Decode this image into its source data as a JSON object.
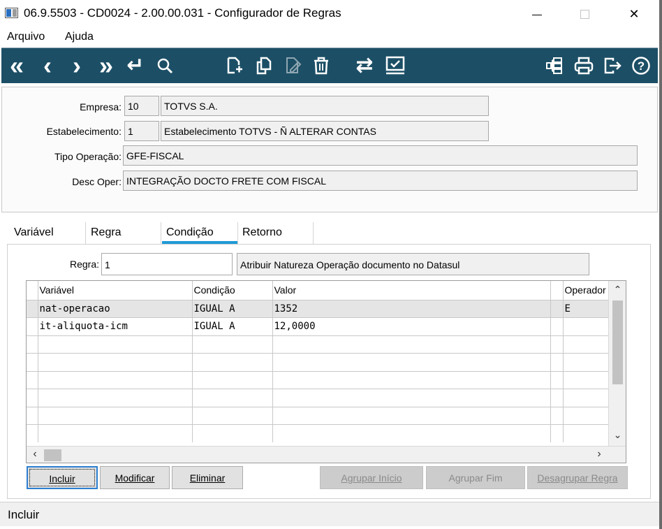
{
  "window": {
    "title": "06.9.5503 - CD0024 - 2.00.00.031 - Configurador de Regras",
    "minimize_icon": "minimize-icon",
    "maximize_icon": "maximize-icon",
    "close_icon": "close-icon",
    "close_glyph": "✕"
  },
  "menu": {
    "items": [
      {
        "label": "Arquivo"
      },
      {
        "label": "Ajuda"
      }
    ]
  },
  "toolbar": {
    "colors": {
      "background": "#1c4f66",
      "icon": "#ffffff"
    },
    "buttons": [
      {
        "icon": "first-record-icon",
        "glyph": "«"
      },
      {
        "icon": "previous-record-icon",
        "glyph": "‹"
      },
      {
        "icon": "next-record-icon",
        "glyph": "›"
      },
      {
        "icon": "last-record-icon",
        "glyph": "»"
      },
      {
        "icon": "goto-icon",
        "glyph": "↵"
      },
      {
        "icon": "search-icon",
        "glyph": "⚲"
      },
      {
        "icon": "new-icon"
      },
      {
        "icon": "copy-icon"
      },
      {
        "icon": "edit-icon"
      },
      {
        "icon": "delete-icon"
      },
      {
        "icon": "exchange-icon",
        "glyph": "⇄"
      },
      {
        "icon": "confirm-icon"
      },
      {
        "icon": "tree-icon"
      },
      {
        "icon": "print-icon"
      },
      {
        "icon": "exit-icon"
      },
      {
        "icon": "help-icon",
        "glyph": "?"
      }
    ]
  },
  "header": {
    "empresa": {
      "label": "Empresa:",
      "code": "10",
      "name": "TOTVS S.A."
    },
    "estabelecimento": {
      "label": "Estabelecimento:",
      "code": "1",
      "name": "Estabelecimento TOTVS - Ñ ALTERAR CONTAS"
    },
    "tipo_operacao": {
      "label": "Tipo Operação:",
      "value": "GFE-FISCAL"
    },
    "desc_oper": {
      "label": "Desc Oper:",
      "value": "INTEGRAÇÃO DOCTO FRETE COM FISCAL"
    }
  },
  "tabs": [
    {
      "label": "Variável",
      "active": false
    },
    {
      "label": "Regra",
      "active": false
    },
    {
      "label": "Condição",
      "active": true
    },
    {
      "label": "Retorno",
      "active": false
    }
  ],
  "condicao": {
    "regra_label": "Regra:",
    "regra_value": "1",
    "regra_desc": "Atribuir Natureza Operação documento no Datasul",
    "grid": {
      "columns": [
        "Variável",
        "Condição",
        "Valor",
        "Operador"
      ],
      "rows": [
        [
          "nat-operacao",
          "IGUAL A",
          "1352",
          "E"
        ],
        [
          "it-aliquota-icm",
          "IGUAL A",
          "12,0000",
          ""
        ],
        [
          "",
          "",
          "",
          ""
        ],
        [
          "",
          "",
          "",
          ""
        ],
        [
          "",
          "",
          "",
          ""
        ],
        [
          "",
          "",
          "",
          ""
        ],
        [
          "",
          "",
          "",
          ""
        ],
        [
          "",
          "",
          "",
          ""
        ]
      ],
      "selected_row": 0
    },
    "buttons": {
      "incluir": "Incluir",
      "modificar": "Modificar",
      "eliminar": "Eliminar",
      "agrupar_inicio": "Agrupar Início",
      "agrupar_fim": "Agrupar Fim",
      "desagrupar_regra": "Desagrupar Regra"
    }
  },
  "status": {
    "text": "Incluir"
  }
}
